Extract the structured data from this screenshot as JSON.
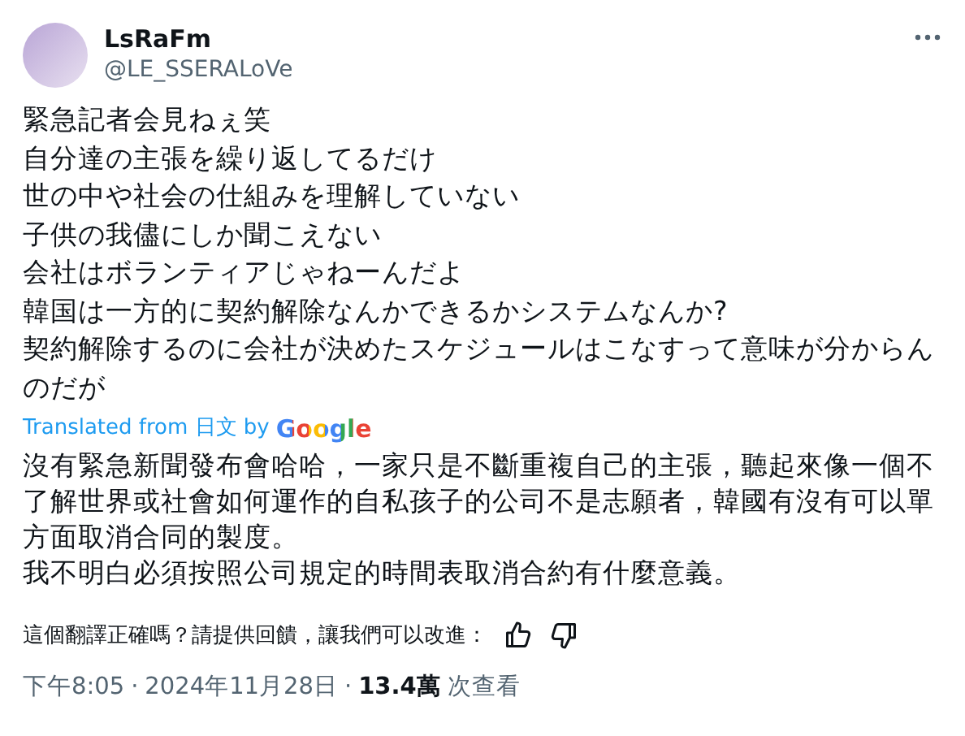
{
  "author": {
    "name": "LsRaFm",
    "handle": "@LE_SSERALoVe"
  },
  "post_lines": [
    "緊急記者会見ねぇ笑",
    "自分達の主張を繰り返してるだけ",
    "世の中や社会の仕組みを理解していない",
    "子供の我儘にしか聞こえない",
    "会社はボランティアじゃねーんだよ",
    "韓国は一方的に契約解除なんかできるかシステムなんか?",
    "契約解除するのに会社が決めたスケジュールはこなすって意味が分からんのだが"
  ],
  "translation": {
    "label": "Translated from 日文 by",
    "provider": "Google",
    "lines": [
      "沒有緊急新聞發布會哈哈，一家只是不斷重複自己的主張，聽起來像一個不了解世界或社會如何運作的自私孩子的公司不是志願者，韓國有沒有可以單方面取消合同的製度。",
      "我不明白必須按照公司規定的時間表取消合約有什麼意義。"
    ]
  },
  "feedback": {
    "prompt": "這個翻譯正確嗎？請提供回饋，讓我們可以改進："
  },
  "meta": {
    "time": "下午8:05",
    "separator_1": "·",
    "date": "2024年11月28日",
    "separator_2": "·",
    "views": "13.4萬",
    "views_label": "次查看"
  }
}
